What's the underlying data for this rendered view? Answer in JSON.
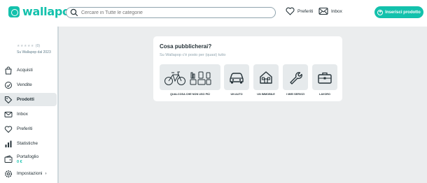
{
  "app": {
    "logo_text": "wallapop",
    "brand_color": "#13c1ac"
  },
  "search": {
    "placeholder": "Cercare in Tutte le categorie"
  },
  "header": {
    "favorites_label": "Preferiti",
    "inbox_label": "Inbox",
    "cta_label": "Inserisci prodotto"
  },
  "profile": {
    "stars": "★★★★★",
    "rating_count": "(0)",
    "member_since": "Su Wallapop dal 2023"
  },
  "sidebar": {
    "items": [
      {
        "label": "Acquisti",
        "icon": "shopping-bag-icon"
      },
      {
        "label": "Vendite",
        "icon": "sales-icon"
      },
      {
        "label": "Prodotti",
        "icon": "tag-icon",
        "active": true
      },
      {
        "label": "Inbox",
        "icon": "mail-icon"
      },
      {
        "label": "Preferiti",
        "icon": "heart-icon"
      },
      {
        "label": "Statistiche",
        "icon": "bar-chart-icon"
      },
      {
        "label": "Portafoglio",
        "sublabel": "0 €",
        "icon": "wallet-icon"
      },
      {
        "label": "Impostazioni",
        "icon": "gear-icon"
      }
    ]
  },
  "upload_card": {
    "title": "Cosa pubblicherai?",
    "subtitle": "Su Wallapop c'è posto per (quasi) tutto",
    "options": [
      {
        "label": "QUALCOSA CHE NON USO PIÙ",
        "icon": "bike-and-items-icon"
      },
      {
        "label": "UN AUTO",
        "icon": "car-icon"
      },
      {
        "label": "UN IMMOBILE",
        "icon": "house-icon"
      },
      {
        "label": "I MIEI SERVIZI",
        "icon": "wrench-icon"
      },
      {
        "label": "LAVORO",
        "icon": "briefcase-icon"
      }
    ]
  }
}
